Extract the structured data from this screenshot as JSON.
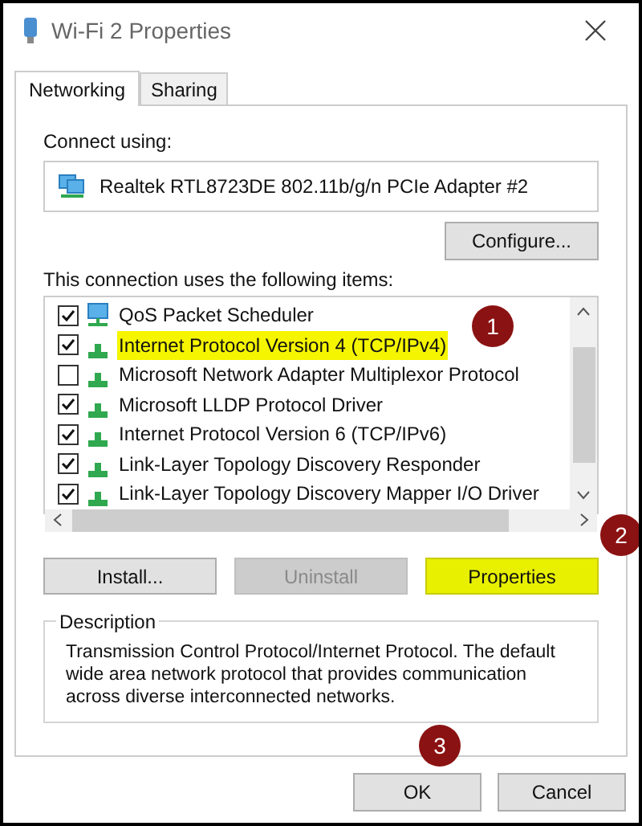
{
  "window": {
    "title": "Wi-Fi 2 Properties"
  },
  "tabs": [
    {
      "label": "Networking",
      "selected": true
    },
    {
      "label": "Sharing",
      "selected": false
    }
  ],
  "connect_using": {
    "label": "Connect using:",
    "adapter": "Realtek RTL8723DE 802.11b/g/n PCIe Adapter #2",
    "configure_button": "Configure..."
  },
  "items_label": "This connection uses the following items:",
  "items": [
    {
      "label": "QoS Packet Scheduler",
      "checked": true,
      "kind": "service",
      "highlighted": false
    },
    {
      "label": "Internet Protocol Version 4 (TCP/IPv4)",
      "checked": true,
      "kind": "protocol",
      "highlighted": true
    },
    {
      "label": "Microsoft Network Adapter Multiplexor Protocol",
      "checked": false,
      "kind": "protocol",
      "highlighted": false
    },
    {
      "label": "Microsoft LLDP Protocol Driver",
      "checked": true,
      "kind": "protocol",
      "highlighted": false
    },
    {
      "label": "Internet Protocol Version 6 (TCP/IPv6)",
      "checked": true,
      "kind": "protocol",
      "highlighted": false
    },
    {
      "label": "Link-Layer Topology Discovery Responder",
      "checked": true,
      "kind": "protocol",
      "highlighted": false
    },
    {
      "label": "Link-Layer Topology Discovery Mapper I/O Driver",
      "checked": true,
      "kind": "protocol",
      "highlighted": false
    }
  ],
  "item_buttons": [
    {
      "label": "Install...",
      "disabled": false,
      "highlighted": false
    },
    {
      "label": "Uninstall",
      "disabled": true,
      "highlighted": false
    },
    {
      "label": "Properties",
      "disabled": false,
      "highlighted": true
    }
  ],
  "description": {
    "title": "Description",
    "text": "Transmission Control Protocol/Internet Protocol. The default wide area network protocol that provides communication across diverse interconnected networks."
  },
  "dialog_buttons": [
    {
      "label": "OK"
    },
    {
      "label": "Cancel"
    }
  ],
  "markers": [
    {
      "label": "1"
    },
    {
      "label": "2"
    },
    {
      "label": "3"
    }
  ]
}
